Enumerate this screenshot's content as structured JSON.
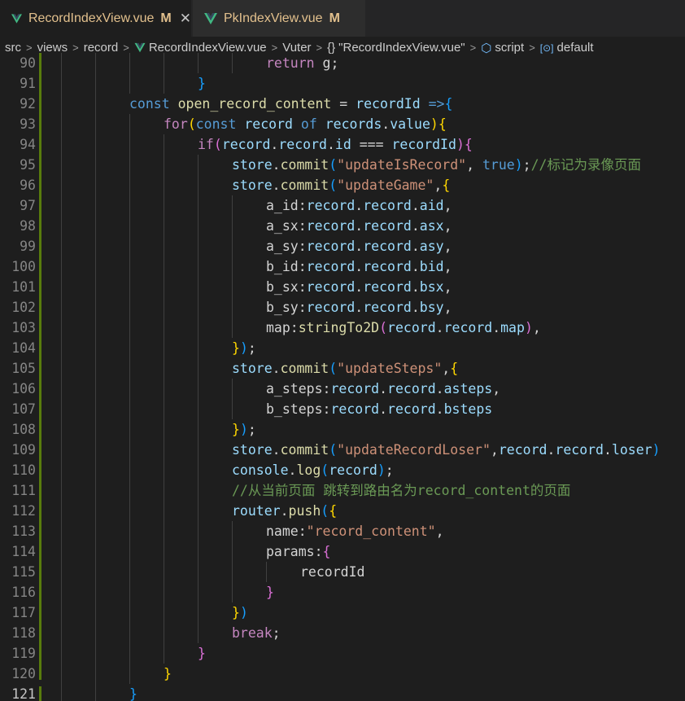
{
  "tabs": [
    {
      "name": "RecordIndexView.vue",
      "modified": "M",
      "close": "✕",
      "active": true
    },
    {
      "name": "PkIndexView.vue",
      "modified": "M",
      "active": false
    }
  ],
  "breadcrumb": [
    "src",
    "views",
    "record",
    "RecordIndexView.vue",
    "Vuter",
    "\"RecordIndexView.vue\"",
    "script",
    "default"
  ],
  "breadcrumb_icons": {
    "vue": "vue-logo-icon",
    "braces": "{}",
    "cube": "⬡",
    "symbol": "[⊙]"
  },
  "lines": [
    {
      "n": "90",
      "tokens": [
        [
          "c",
          "return"
        ],
        [
          "p",
          " g;"
        ]
      ]
    },
    {
      "n": "91",
      "tokens": [
        [
          "b3",
          "}"
        ]
      ]
    },
    {
      "n": "92",
      "tokens": [
        [
          "k",
          "const"
        ],
        [
          "p",
          " "
        ],
        [
          "f",
          "open_record_content"
        ],
        [
          "p",
          " = "
        ],
        [
          "v",
          "recordId"
        ],
        [
          "p",
          " "
        ],
        [
          "k",
          "=>"
        ],
        [
          "b3",
          "{"
        ]
      ]
    },
    {
      "n": "93",
      "tokens": [
        [
          "c",
          "for"
        ],
        [
          "b1",
          "("
        ],
        [
          "k",
          "const"
        ],
        [
          "p",
          " "
        ],
        [
          "v",
          "record"
        ],
        [
          "p",
          " "
        ],
        [
          "k",
          "of"
        ],
        [
          "p",
          " "
        ],
        [
          "v",
          "records"
        ],
        [
          "p",
          "."
        ],
        [
          "v",
          "value"
        ],
        [
          "b1",
          ")"
        ],
        [
          "b1",
          "{"
        ]
      ]
    },
    {
      "n": "94",
      "tokens": [
        [
          "c",
          "if"
        ],
        [
          "b2",
          "("
        ],
        [
          "v",
          "record"
        ],
        [
          "p",
          "."
        ],
        [
          "v",
          "record"
        ],
        [
          "p",
          "."
        ],
        [
          "v",
          "id"
        ],
        [
          "p",
          " === "
        ],
        [
          "v",
          "recordId"
        ],
        [
          "b2",
          ")"
        ],
        [
          "b2",
          "{"
        ]
      ]
    },
    {
      "n": "95",
      "tokens": [
        [
          "v",
          "store"
        ],
        [
          "p",
          "."
        ],
        [
          "f",
          "commit"
        ],
        [
          "b3",
          "("
        ],
        [
          "s",
          "\"updateIsRecord\""
        ],
        [
          "p",
          ", "
        ],
        [
          "k",
          "true"
        ],
        [
          "b3",
          ")"
        ],
        [
          "p",
          ";"
        ],
        [
          "cm",
          "//标记为录像页面"
        ]
      ]
    },
    {
      "n": "96",
      "tokens": [
        [
          "v",
          "store"
        ],
        [
          "p",
          "."
        ],
        [
          "f",
          "commit"
        ],
        [
          "b3",
          "("
        ],
        [
          "s",
          "\"updateGame\""
        ],
        [
          "p",
          ","
        ],
        [
          "b1",
          "{"
        ]
      ]
    },
    {
      "n": "97",
      "tokens": [
        [
          "p",
          "a_id:"
        ],
        [
          "v",
          "record"
        ],
        [
          "p",
          "."
        ],
        [
          "v",
          "record"
        ],
        [
          "p",
          "."
        ],
        [
          "v",
          "aid"
        ],
        [
          "p",
          ","
        ]
      ]
    },
    {
      "n": "98",
      "tokens": [
        [
          "p",
          "a_sx:"
        ],
        [
          "v",
          "record"
        ],
        [
          "p",
          "."
        ],
        [
          "v",
          "record"
        ],
        [
          "p",
          "."
        ],
        [
          "v",
          "asx"
        ],
        [
          "p",
          ","
        ]
      ]
    },
    {
      "n": "99",
      "tokens": [
        [
          "p",
          "a_sy:"
        ],
        [
          "v",
          "record"
        ],
        [
          "p",
          "."
        ],
        [
          "v",
          "record"
        ],
        [
          "p",
          "."
        ],
        [
          "v",
          "asy"
        ],
        [
          "p",
          ","
        ]
      ]
    },
    {
      "n": "100",
      "tokens": [
        [
          "p",
          "b_id:"
        ],
        [
          "v",
          "record"
        ],
        [
          "p",
          "."
        ],
        [
          "v",
          "record"
        ],
        [
          "p",
          "."
        ],
        [
          "v",
          "bid"
        ],
        [
          "p",
          ","
        ]
      ]
    },
    {
      "n": "101",
      "tokens": [
        [
          "p",
          "b_sx:"
        ],
        [
          "v",
          "record"
        ],
        [
          "p",
          "."
        ],
        [
          "v",
          "record"
        ],
        [
          "p",
          "."
        ],
        [
          "v",
          "bsx"
        ],
        [
          "p",
          ","
        ]
      ]
    },
    {
      "n": "102",
      "tokens": [
        [
          "p",
          "b_sy:"
        ],
        [
          "v",
          "record"
        ],
        [
          "p",
          "."
        ],
        [
          "v",
          "record"
        ],
        [
          "p",
          "."
        ],
        [
          "v",
          "bsy"
        ],
        [
          "p",
          ","
        ]
      ]
    },
    {
      "n": "103",
      "tokens": [
        [
          "p",
          "map:"
        ],
        [
          "f",
          "stringTo2D"
        ],
        [
          "b2",
          "("
        ],
        [
          "v",
          "record"
        ],
        [
          "p",
          "."
        ],
        [
          "v",
          "record"
        ],
        [
          "p",
          "."
        ],
        [
          "v",
          "map"
        ],
        [
          "b2",
          ")"
        ],
        [
          "p",
          ","
        ]
      ]
    },
    {
      "n": "104",
      "tokens": [
        [
          "b1",
          "}"
        ],
        [
          "b3",
          ")"
        ],
        [
          "p",
          ";"
        ]
      ]
    },
    {
      "n": "105",
      "tokens": [
        [
          "v",
          "store"
        ],
        [
          "p",
          "."
        ],
        [
          "f",
          "commit"
        ],
        [
          "b3",
          "("
        ],
        [
          "s",
          "\"updateSteps\""
        ],
        [
          "p",
          ","
        ],
        [
          "b1",
          "{"
        ]
      ]
    },
    {
      "n": "106",
      "tokens": [
        [
          "p",
          "a_steps:"
        ],
        [
          "v",
          "record"
        ],
        [
          "p",
          "."
        ],
        [
          "v",
          "record"
        ],
        [
          "p",
          "."
        ],
        [
          "v",
          "asteps"
        ],
        [
          "p",
          ","
        ]
      ]
    },
    {
      "n": "107",
      "tokens": [
        [
          "p",
          "b_steps:"
        ],
        [
          "v",
          "record"
        ],
        [
          "p",
          "."
        ],
        [
          "v",
          "record"
        ],
        [
          "p",
          "."
        ],
        [
          "v",
          "bsteps"
        ]
      ]
    },
    {
      "n": "108",
      "tokens": [
        [
          "b1",
          "}"
        ],
        [
          "b3",
          ")"
        ],
        [
          "p",
          ";"
        ]
      ]
    },
    {
      "n": "109",
      "tokens": [
        [
          "v",
          "store"
        ],
        [
          "p",
          "."
        ],
        [
          "f",
          "commit"
        ],
        [
          "b3",
          "("
        ],
        [
          "s",
          "\"updateRecordLoser\""
        ],
        [
          "p",
          ","
        ],
        [
          "v",
          "record"
        ],
        [
          "p",
          "."
        ],
        [
          "v",
          "record"
        ],
        [
          "p",
          "."
        ],
        [
          "v",
          "loser"
        ],
        [
          "b3",
          ")"
        ]
      ]
    },
    {
      "n": "110",
      "tokens": [
        [
          "v",
          "console"
        ],
        [
          "p",
          "."
        ],
        [
          "f",
          "log"
        ],
        [
          "b3",
          "("
        ],
        [
          "v",
          "record"
        ],
        [
          "b3",
          ")"
        ],
        [
          "p",
          ";"
        ]
      ]
    },
    {
      "n": "111",
      "tokens": [
        [
          "cm",
          "//从当前页面 跳转到路由名为record_content的页面"
        ]
      ]
    },
    {
      "n": "112",
      "tokens": [
        [
          "v",
          "router"
        ],
        [
          "p",
          "."
        ],
        [
          "f",
          "push"
        ],
        [
          "b3",
          "("
        ],
        [
          "b1",
          "{"
        ]
      ]
    },
    {
      "n": "113",
      "tokens": [
        [
          "p",
          "name:"
        ],
        [
          "s",
          "\"record_content\""
        ],
        [
          "p",
          ","
        ]
      ]
    },
    {
      "n": "114",
      "tokens": [
        [
          "p",
          "params:"
        ],
        [
          "b2",
          "{"
        ]
      ]
    },
    {
      "n": "115",
      "tokens": [
        [
          "p",
          "recordId"
        ]
      ]
    },
    {
      "n": "116",
      "tokens": [
        [
          "b2",
          "}"
        ]
      ]
    },
    {
      "n": "117",
      "tokens": [
        [
          "b1",
          "}"
        ],
        [
          "b3",
          ")"
        ]
      ]
    },
    {
      "n": "118",
      "tokens": [
        [
          "c",
          "break"
        ],
        [
          "p",
          ";"
        ]
      ]
    },
    {
      "n": "119",
      "tokens": [
        [
          "b2",
          "}"
        ]
      ]
    },
    {
      "n": "120",
      "tokens": [
        [
          "b1",
          "}"
        ]
      ]
    },
    {
      "n": "121",
      "tokens": [
        [
          "b3",
          "}"
        ]
      ]
    }
  ],
  "colors": {
    "keyword": "#569cd6",
    "control": "#c586c0",
    "function": "#dcdcaa",
    "variable": "#9cdcfe",
    "string": "#ce9178",
    "comment": "#6a9955",
    "tab_text": "#e2c08d"
  }
}
